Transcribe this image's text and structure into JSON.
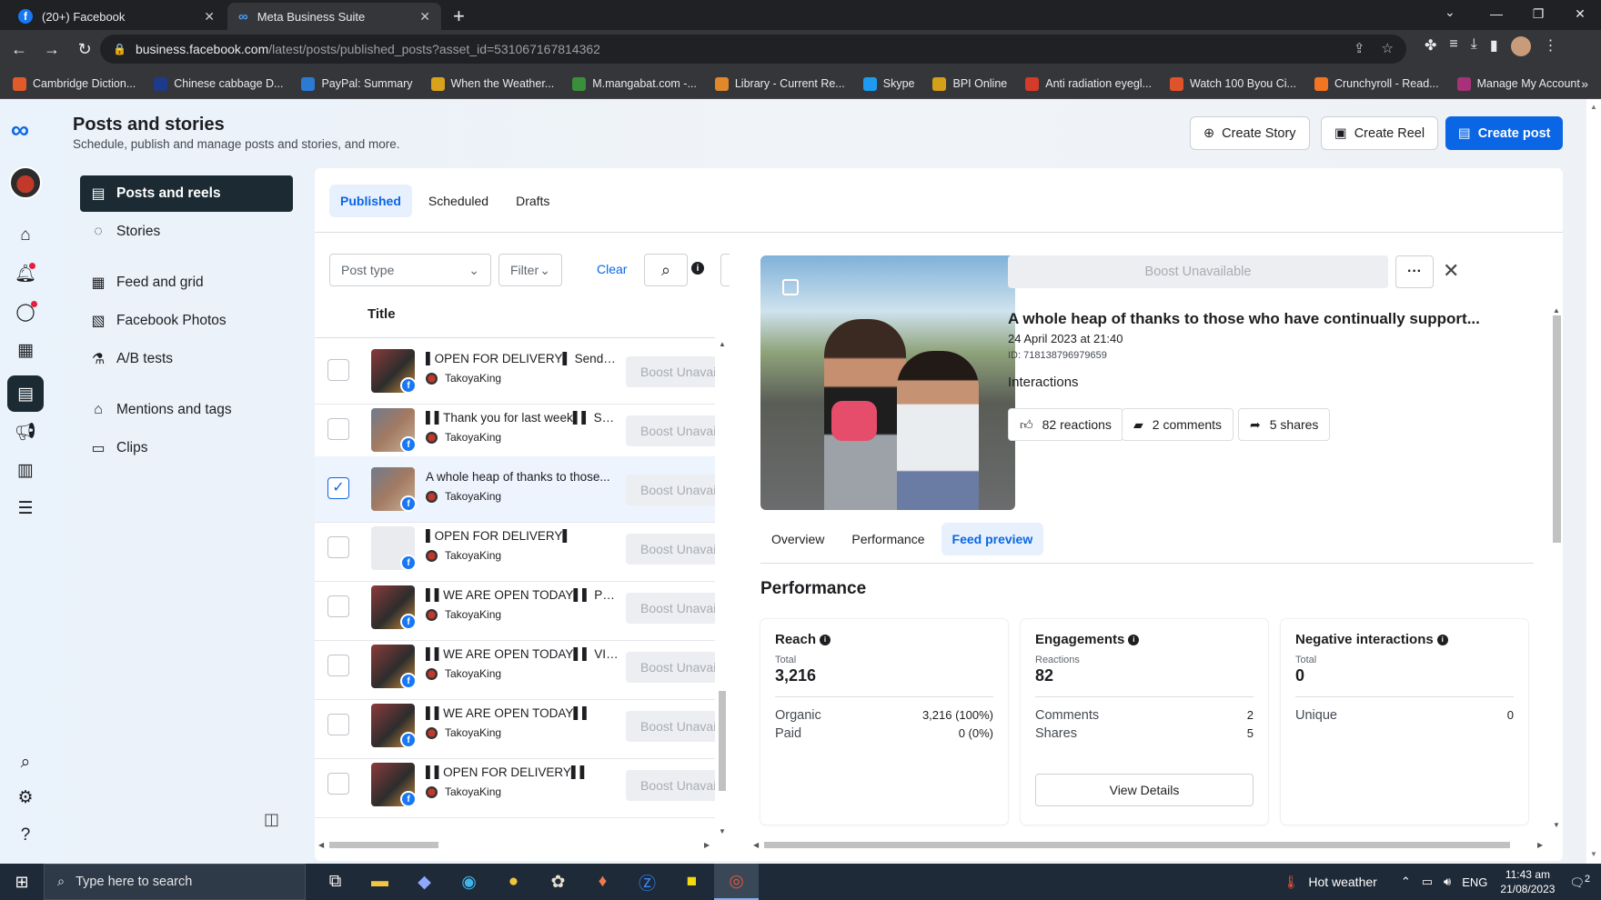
{
  "browser": {
    "tabs": [
      {
        "title": "(20+) Facebook",
        "active": false
      },
      {
        "title": "Meta Business Suite",
        "active": true
      }
    ],
    "url_host": "business.facebook.com",
    "url_path": "/latest/posts/published_posts?asset_id=531067167814362",
    "bookmarks": [
      {
        "label": "Cambridge Diction...",
        "color": "#e05a2a"
      },
      {
        "label": "Chinese cabbage D...",
        "color": "#1d3b8a"
      },
      {
        "label": "PayPal: Summary",
        "color": "#2b7bd3"
      },
      {
        "label": "When the Weather...",
        "color": "#d9a21b"
      },
      {
        "label": "M.mangabat.com -...",
        "color": "#3a8f3a"
      },
      {
        "label": "Library - Current Re...",
        "color": "#e0882a"
      },
      {
        "label": "Skype",
        "color": "#1d9bf0"
      },
      {
        "label": "BPI Online",
        "color": "#d4a017"
      },
      {
        "label": "Anti radiation eyegl...",
        "color": "#d63a2a"
      },
      {
        "label": "Watch 100 Byou Ci...",
        "color": "#e0522a"
      },
      {
        "label": "Crunchyroll - Read...",
        "color": "#f47521"
      },
      {
        "label": "Manage My Account",
        "color": "#a83279"
      }
    ]
  },
  "header": {
    "title": "Posts and stories",
    "subtitle": "Schedule, publish and manage posts and stories, and more.",
    "create_story": "Create Story",
    "create_reel": "Create Reel",
    "create_post": "Create post"
  },
  "subnav": [
    {
      "label": "Posts and reels",
      "icon": "posts-icon",
      "active": true
    },
    {
      "label": "Stories",
      "icon": "stories-icon",
      "active": false
    },
    {
      "label": "Feed and grid",
      "icon": "feed-grid-icon",
      "active": false
    },
    {
      "label": "Facebook Photos",
      "icon": "photos-icon",
      "active": false
    },
    {
      "label": "A/B tests",
      "icon": "flask-icon",
      "active": false
    },
    {
      "label": "Mentions and tags",
      "icon": "tag-icon",
      "active": false
    },
    {
      "label": "Clips",
      "icon": "clips-icon",
      "active": false
    }
  ],
  "tabs": [
    "Published",
    "Scheduled",
    "Drafts"
  ],
  "filters": {
    "post_type": "Post type",
    "filter": "Filter",
    "clear": "Clear"
  },
  "list": {
    "column_title": "Title",
    "boost_label": "Boost Unavailable",
    "rows": [
      {
        "title": "▌OPEN FOR DELIVERY▌ Send a ...",
        "page": "TakoyaKing",
        "thumb": "food",
        "selected": false
      },
      {
        "title": "▌▌Thank you for last week▌▌ SE...",
        "page": "TakoyaKing",
        "thumb": "photo",
        "selected": false
      },
      {
        "title": "A whole heap of thanks to those...",
        "page": "TakoyaKing",
        "thumb": "photo",
        "selected": true
      },
      {
        "title": "▌OPEN FOR DELIVERY▌",
        "page": "TakoyaKing",
        "thumb": "blank",
        "selected": false
      },
      {
        "title": "▌▌WE ARE OPEN TODAY▌▌ PLEA...",
        "page": "TakoyaKing",
        "thumb": "food",
        "selected": false
      },
      {
        "title": "▌▌WE ARE OPEN TODAY▌▌ VISIT...",
        "page": "TakoyaKing",
        "thumb": "food",
        "selected": false
      },
      {
        "title": "▌▌WE ARE OPEN TODAY▌▌",
        "page": "TakoyaKing",
        "thumb": "food",
        "selected": false
      },
      {
        "title": "▌▌OPEN FOR DELIVERY▌▌",
        "page": "TakoyaKing",
        "thumb": "food",
        "selected": false
      }
    ]
  },
  "detail": {
    "boost": "Boost Unavailable",
    "more": "···",
    "title": "A whole heap of thanks to those who have continually support...",
    "date": "24 April 2023 at 21:40",
    "id": "ID: 718138796979659",
    "interactions_label": "Interactions",
    "reactions": "82 reactions",
    "comments": "2 comments",
    "shares": "5 shares",
    "tabs": [
      "Overview",
      "Performance",
      "Feed preview"
    ],
    "active_tab": "Feed preview",
    "performance_heading": "Performance",
    "reach": {
      "title": "Reach",
      "sublabel": "Total",
      "total": "3,216",
      "organic_label": "Organic",
      "organic_value": "3,216 (100%)",
      "paid_label": "Paid",
      "paid_value": "0 (0%)"
    },
    "engagements": {
      "title": "Engagements",
      "sublabel": "Reactions",
      "total": "82",
      "comments_label": "Comments",
      "comments_value": "2",
      "shares_label": "Shares",
      "shares_value": "5",
      "view_details": "View Details"
    },
    "negative": {
      "title": "Negative interactions",
      "sublabel": "Total",
      "total": "0",
      "unique_label": "Unique",
      "unique_value": "0"
    }
  },
  "taskbar": {
    "search_placeholder": "Type here to search",
    "weather": "Hot weather",
    "lang": "ENG",
    "time": "11:43 am",
    "date": "21/08/2023",
    "notifications": "2"
  }
}
